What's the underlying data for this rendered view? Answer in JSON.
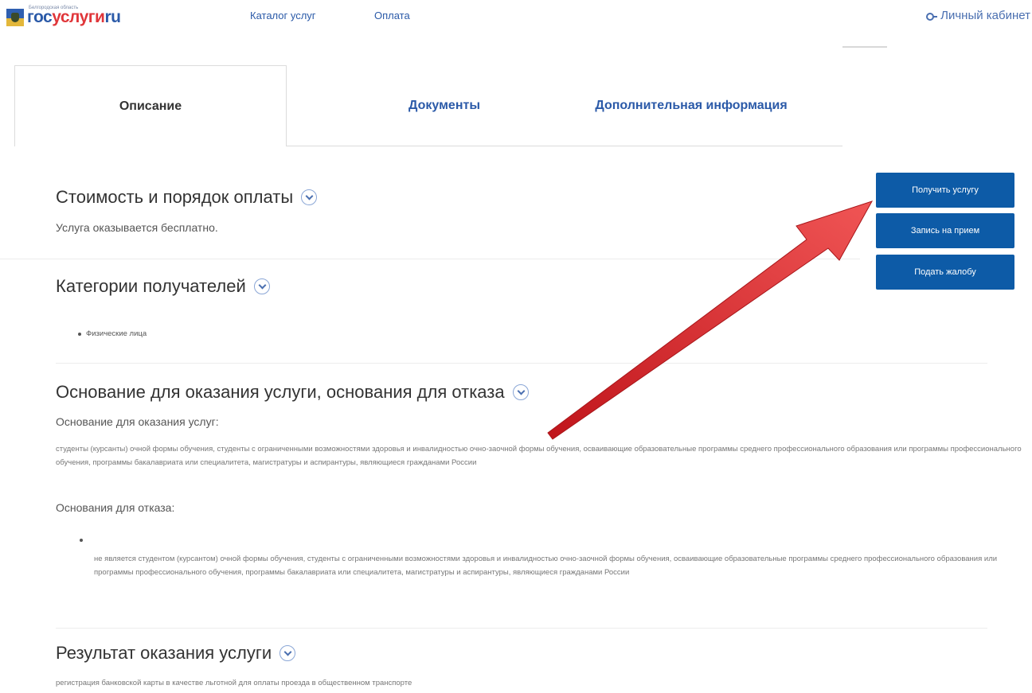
{
  "header": {
    "logo_gos": "гос",
    "logo_usl": "услуги",
    "logo_ru": "ru",
    "logo_tag": "Белгородская область",
    "nav": [
      "Каталог услуг",
      "Оплата"
    ],
    "cabinet": "Личный кабинет"
  },
  "tabs": [
    "Описание",
    "Документы",
    "Дополнительная информация"
  ],
  "sections": {
    "cost_title": "Стоимость и порядок оплаты",
    "cost_text": "Услуга оказывается бесплатно.",
    "recipients_title": "Категории получателей",
    "recipients_item": "Физические лица",
    "basis_title": "Основание для оказания услуги, основания для отказа",
    "basis_sub": "Основание для оказания услуг:",
    "basis_text": "студенты (курсанты) очной формы обучения, студенты с ограниченными возможностями здоровья и инвалидностью очно-заочной формы обучения, осваивающие образовательные программы среднего профессионального образования или программы профессионального обучения, программы бакалавриата или специалитета, магистратуры и аспирантуры, являющиеся гражданами России",
    "refusal_sub": "Основания для отказа:",
    "refusal_text": "не является студентом (курсантом) очной формы обучения, студенты с ограниченными возможностями здоровья и инвалидностью очно-заочной формы обучения, осваивающие образовательные программы среднего профессионального образования или программы профессионального обучения, программы бакалавриата или специалитета, магистратуры и аспирантуры, являющиеся гражданами России",
    "result_title": "Результат оказания услуги",
    "result_text": "регистрация банковской карты в качестве льготной для оплаты проезда в общественном транспорте"
  },
  "buttons": {
    "get_service": "Получить услугу",
    "appointment": "Запись на прием",
    "complaint": "Подать жалобу"
  },
  "colors": {
    "brand_blue": "#0d5ba7",
    "link_blue": "#2b5aa8",
    "arrow_red": "#d8262a"
  }
}
